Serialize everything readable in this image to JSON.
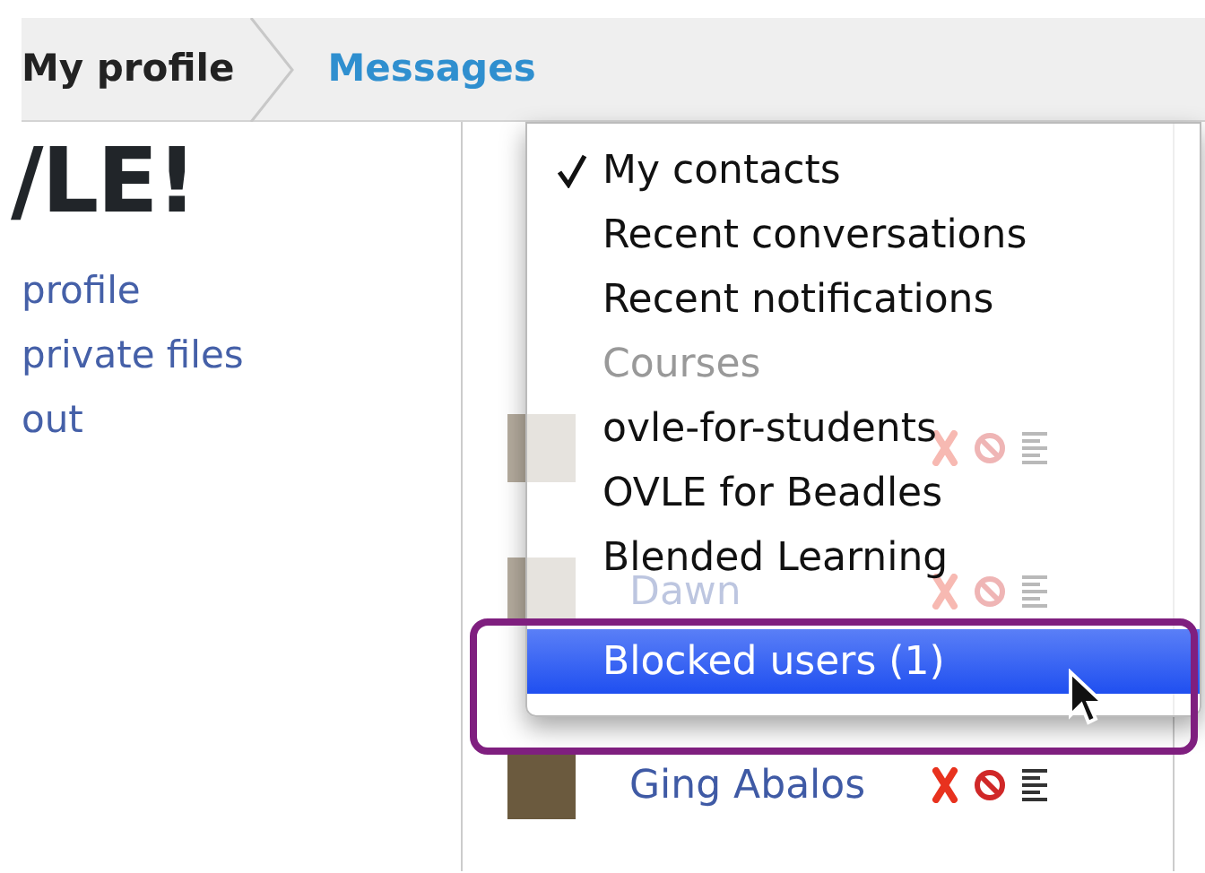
{
  "breadcrumb": [
    {
      "label": "My profile",
      "current": false
    },
    {
      "label": "Messages",
      "current": true
    }
  ],
  "heading": "/LE!",
  "links": [
    "profile",
    "private files",
    "out"
  ],
  "contacts": [
    {
      "faded": true
    },
    {
      "name": "Dawn",
      "faded": true
    },
    {
      "name": "Ging Abalos",
      "faded": false
    }
  ],
  "menu": [
    {
      "kind": "item",
      "label": "My contacts",
      "checked": true,
      "selected": false,
      "disabled": false
    },
    {
      "kind": "item",
      "label": "Recent conversations",
      "checked": false,
      "selected": false,
      "disabled": false
    },
    {
      "kind": "item",
      "label": "Recent notifications",
      "checked": false,
      "selected": false,
      "disabled": false
    },
    {
      "kind": "item",
      "label": "Courses",
      "checked": false,
      "selected": false,
      "disabled": true
    },
    {
      "kind": "item",
      "label": "ovle-for-students",
      "checked": false,
      "selected": false,
      "disabled": false
    },
    {
      "kind": "item",
      "label": "OVLE for Beadles",
      "checked": false,
      "selected": false,
      "disabled": false
    },
    {
      "kind": "item",
      "label": "Blended Learning",
      "checked": false,
      "selected": false,
      "disabled": false
    },
    {
      "kind": "separator"
    },
    {
      "kind": "item",
      "label": "Blocked users (1)",
      "checked": false,
      "selected": true,
      "disabled": false
    }
  ]
}
